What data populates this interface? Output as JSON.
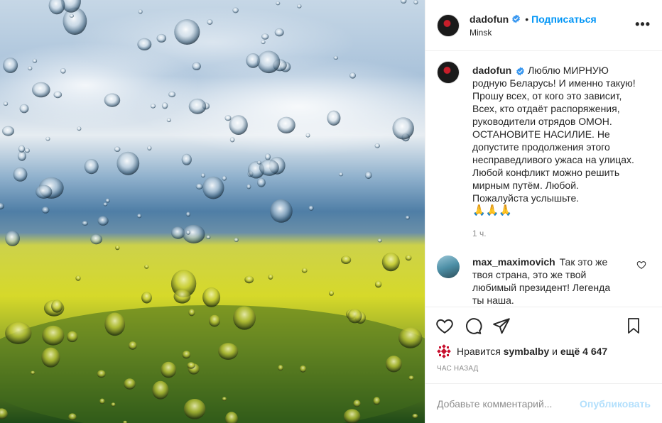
{
  "post": {
    "image_alt": "raindrops on window over yellow field",
    "author": {
      "username": "dadofun",
      "follow_label": "Подписаться",
      "separator": "•",
      "location": "Minsk",
      "more_label": "•••"
    },
    "caption": {
      "username": "dadofun",
      "text": "Люблю МИРНУЮ родную Беларусь! И именно такую! Прошу всех, от кого это зависит, Всех, кто отдаёт распоряжения, руководители отрядов ОМОН. ОСТАНОВИТЕ НАСИЛИЕ. Не допустите продолжения этого несправедливого ужаса на улицах. Любой конфликт можно решить мирным путём. Любой. Пожалуйста услышьте.",
      "emoji": "🙏🙏🙏",
      "time": "1 ч."
    },
    "comments": [
      {
        "username": "max_maximovich",
        "text": "Так это же твоя страна, это же твой любимый президент! Легенда ты наша."
      }
    ],
    "likes": {
      "prefix": "Нравится",
      "user": "symbalby",
      "middle": "и",
      "others": "ещё 4 647"
    },
    "posted_ago": "ЧАС НАЗАД",
    "add_comment": {
      "placeholder": "Добавьте комментарий...",
      "publish_label": "Опубликовать"
    }
  },
  "colors": {
    "accent": "#0095f6",
    "publish_disabled": "#b2dffc",
    "muted": "#8e8e8e",
    "text": "#262626"
  }
}
